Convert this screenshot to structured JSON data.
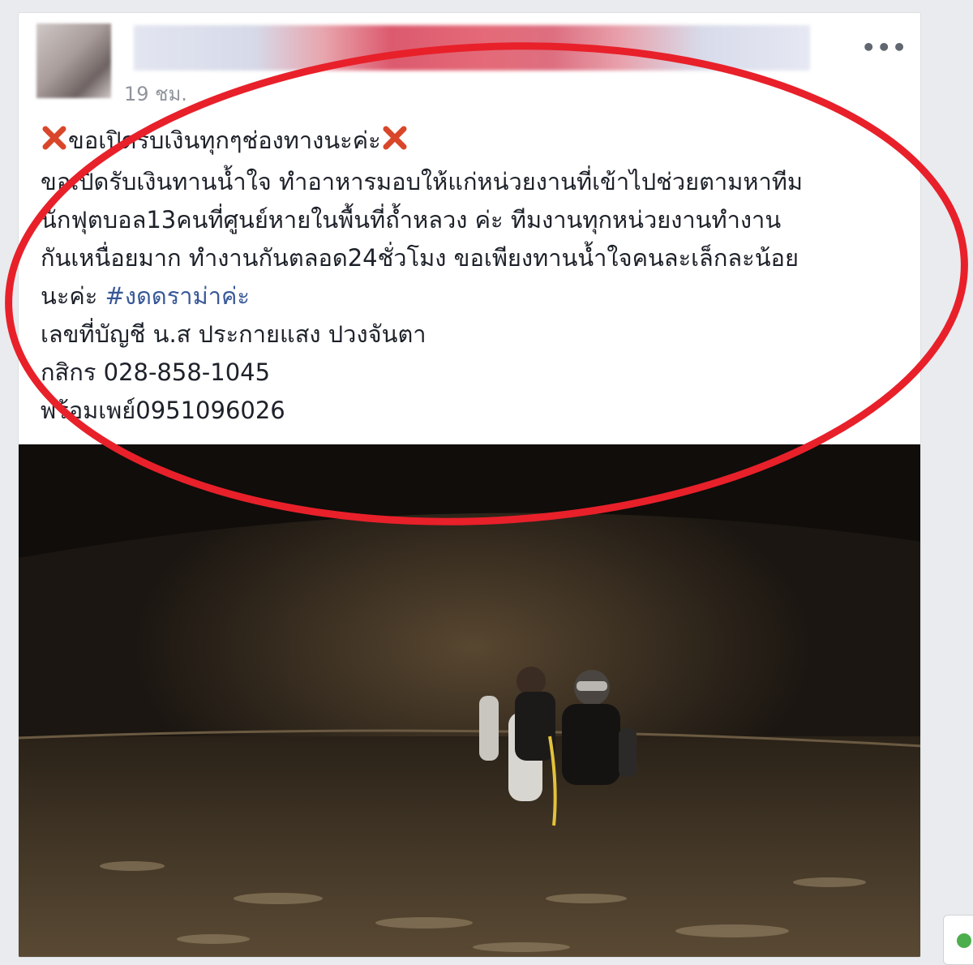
{
  "post": {
    "timestamp": "19 ชม.",
    "more_label": "•••",
    "lines": [
      "ขอเปิดรับเงินทุกๆช่องทางนะค่ะ",
      "ขอเปิดรับเงินทานน้ำใจ ทำอาหารมอบให้แก่หน่วยงานที่เข้าไปช่วยตามหาทีม",
      "นักฟุตบอล13คนที่ศูนย์หายในพื้นที่ถ้ำหลวง ค่ะ ทีมงานทุกหน่วยงานทำงาน",
      "กันเหนื่อยมาก ทำงานกันตลอด24ชั่วโมง ขอเพียงทานน้ำใจคนละเล็กละน้อย",
      "นะค่ะ",
      "เลขที่บัญชี น.ส ประกายแสง ปวงจันตา",
      "กสิกร 028-858-1045",
      "พร้อมเพย์0951096026"
    ],
    "hashtag": "#งดดราม่าค่ะ"
  },
  "icons": {
    "cross": "cross-mark-icon",
    "more": "more-options-icon"
  },
  "colors": {
    "highlight_ring": "#e8202a",
    "cross_mark": "#d9472b",
    "hashtag": "#385898",
    "timestamp": "#90949c"
  }
}
